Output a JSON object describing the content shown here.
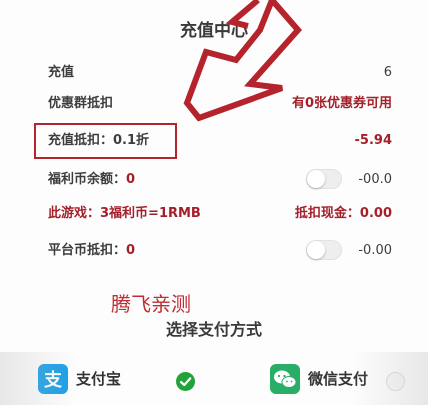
{
  "header": {
    "title": "充值中心"
  },
  "rows": {
    "recharge": {
      "label": "充值",
      "value": "6"
    },
    "coupon": {
      "label": "优惠群抵扣",
      "value": "有0张优惠券可用"
    },
    "discount": {
      "label": "充值抵扣：0.1折",
      "value": "-5.94"
    },
    "welfare": {
      "label_prefix": "福利币余额：",
      "amount": "0",
      "value": "-00.0",
      "toggle_on": false
    },
    "game": {
      "label": "此游戏：3福利币=1RMB",
      "value": "抵扣现金：0.00"
    },
    "platform": {
      "label_prefix": "平台币抵扣：",
      "amount": "0",
      "value": "-0.00",
      "toggle_on": false
    }
  },
  "watermark": "腾飞亲测",
  "payment": {
    "section_title": "选择支付方式",
    "methods": [
      {
        "name": "支付宝",
        "icon": "alipay-icon",
        "selected": true
      },
      {
        "name": "微信支付",
        "icon": "wechat-icon",
        "selected": false
      }
    ]
  },
  "colors": {
    "accent_red": "#a3202a",
    "annotation_red": "#b5242c",
    "check_green": "#22a33a",
    "alipay_blue": "#1a9fe8",
    "wechat_green": "#2aae67"
  }
}
